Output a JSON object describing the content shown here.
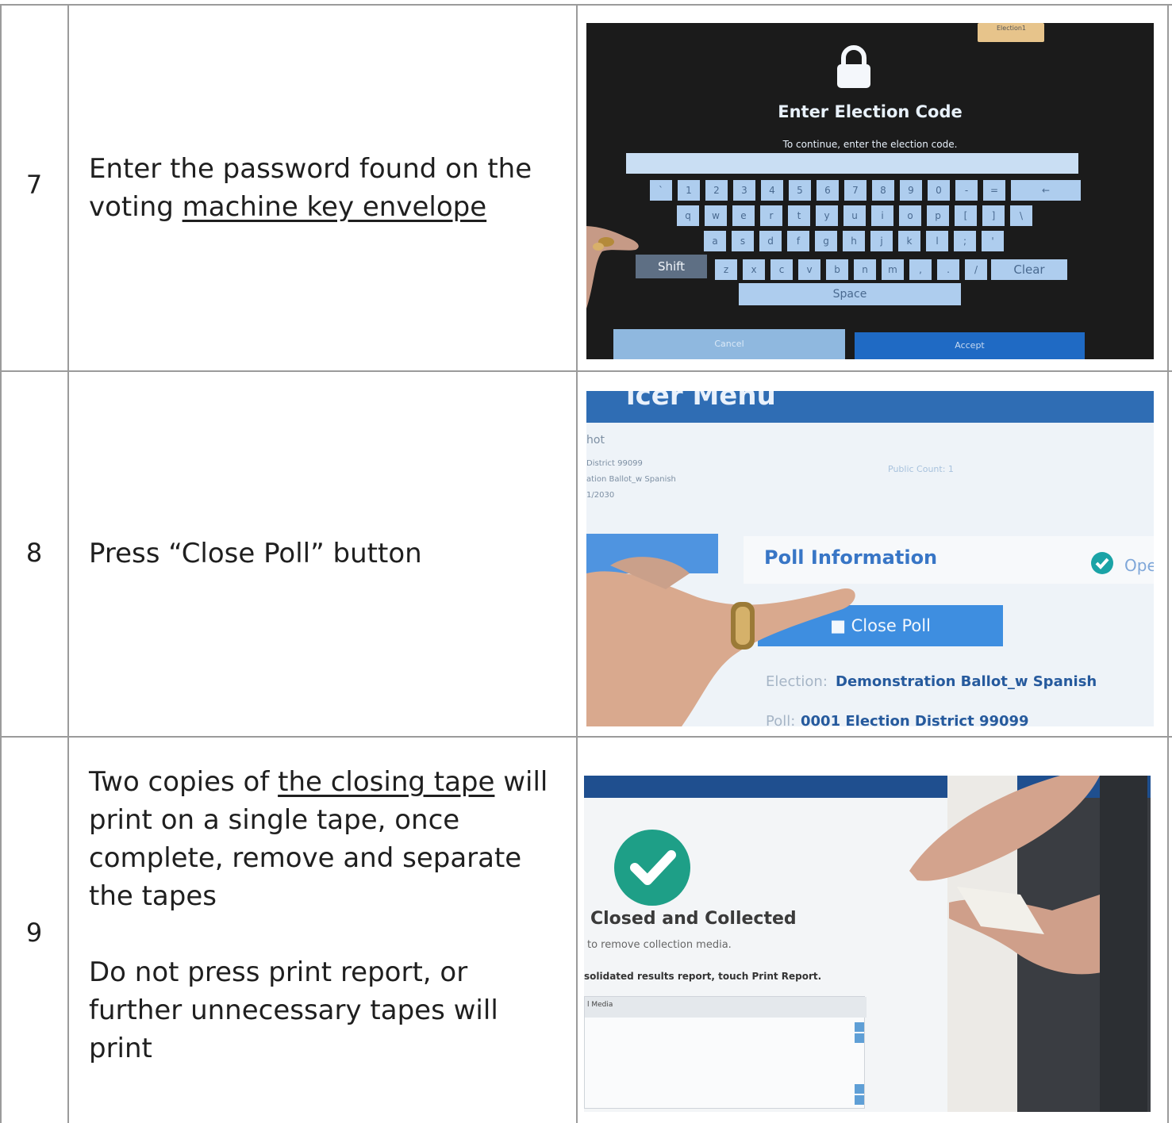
{
  "rows": [
    {
      "number": "7",
      "text_before": "Enter the password found on the voting ",
      "link": "machine key envelope",
      "text_after": ""
    },
    {
      "number": "8",
      "text": "Press “Close Poll” button"
    },
    {
      "number": "9",
      "p1_before": "Two copies of ",
      "p1_link": "the closing tape",
      "p1_after": " will print on a single tape, once complete, remove and separate the tapes",
      "p2": "Do not press print report, or further unnecessary tapes will print"
    }
  ],
  "photo1": {
    "envelope_label": "Election1",
    "title": "Enter Election Code",
    "subtitle": "To continue, enter the election code.",
    "row1": [
      "`",
      "1",
      "2",
      "3",
      "4",
      "5",
      "6",
      "7",
      "8",
      "9",
      "0",
      "-",
      "=",
      "←"
    ],
    "row2": [
      "q",
      "w",
      "e",
      "r",
      "t",
      "y",
      "u",
      "i",
      "o",
      "p",
      "[",
      "]",
      "\\"
    ],
    "row3": [
      "a",
      "s",
      "d",
      "f",
      "g",
      "h",
      "j",
      "k",
      "l",
      ";",
      "'"
    ],
    "shift": "Shift",
    "row4": [
      "z",
      "x",
      "c",
      "v",
      "b",
      "n",
      "m",
      ",",
      ".",
      "/"
    ],
    "clear": "Clear",
    "space": "Space",
    "cancel": "Cancel",
    "accept": "Accept"
  },
  "photo2": {
    "header_fragment": "icer Menu",
    "line1": "hot",
    "line2": "District 99099",
    "line3": "ation Ballot_w Spanish",
    "line4": "1/2030",
    "public_count": "Public Count: 1",
    "section": "Poll Information",
    "status": "Ope",
    "button": "Close Poll",
    "election_label": "Election:",
    "election_value": "Demonstration Ballot_w Spanish",
    "poll_label": "Poll:",
    "poll_value": "0001 Election District 99099"
  },
  "photo3": {
    "heading": "Closed and Collected",
    "line1": "to remove collection media.",
    "line2": "solidated results report, touch Print Report.",
    "panel_header": "l Media"
  }
}
